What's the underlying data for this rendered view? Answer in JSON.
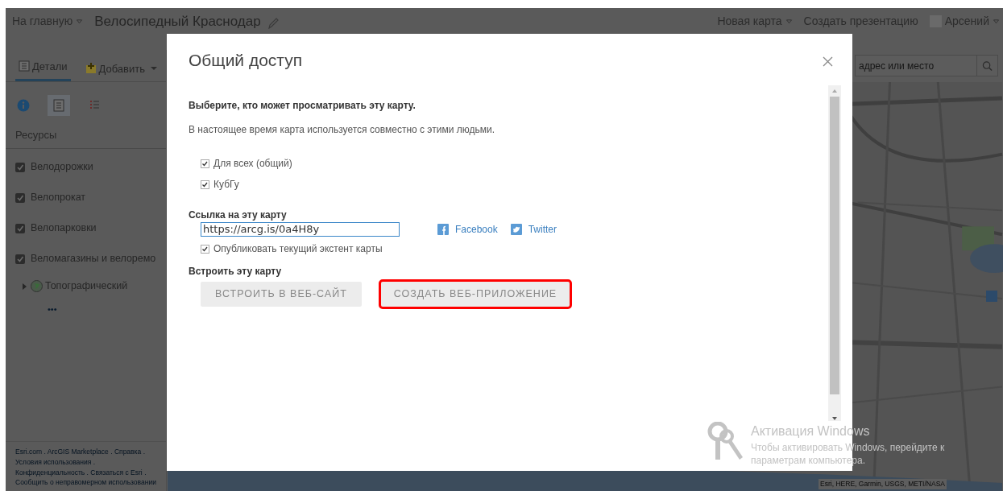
{
  "header": {
    "home": "На главную",
    "title": "Велосипедный Краснодар",
    "links": [
      {
        "label": "Новая карта",
        "dropdown": true
      },
      {
        "label": "Создать презентацию",
        "dropdown": false
      }
    ],
    "user": "Арсений"
  },
  "toolbar": {
    "tabs": [
      {
        "label": "Детали",
        "kind": "details",
        "selected": true,
        "dropdown": false
      },
      {
        "label": "Добавить",
        "kind": "add",
        "selected": false,
        "dropdown": true
      }
    ]
  },
  "panel": {
    "view_buttons": [
      {
        "kind": "info",
        "selected": false
      },
      {
        "kind": "content",
        "selected": true
      },
      {
        "kind": "legend",
        "selected": false
      }
    ],
    "heading": "Ресурсы",
    "layers": [
      {
        "label": "Велодорожки",
        "checked": true
      },
      {
        "label": "Велопрокат",
        "checked": true
      },
      {
        "label": "Велопарковки",
        "checked": true
      },
      {
        "label": "Веломагазины и велоремо",
        "checked": true
      }
    ],
    "basemap": {
      "label": "Топографический",
      "expanded": false,
      "more": "•••"
    },
    "footer_separator": ".",
    "footer_links": [
      "Esri.com",
      "ArcGIS Marketplace",
      "Справка",
      "Условия использования",
      "Конфиденциальность",
      "Связаться с Esri",
      "Сообщить о неправомерном использовании"
    ]
  },
  "search": {
    "placeholder": "адрес или место"
  },
  "map": {
    "attribution": "Esri, HERE, Garmin, USGS, METI/NASA"
  },
  "dialog": {
    "title": "Общий доступ",
    "who_heading": "Выберите, кто может просматривать эту карту.",
    "who_note": "В настоящее время карта используется совместно с этими людьми.",
    "audiences": [
      {
        "label": "Для всех (общий)",
        "checked": true
      },
      {
        "label": "КубГу",
        "checked": true
      }
    ],
    "link_heading": "Ссылка на эту карту",
    "link_value": "https://arcg.is/0a4H8y",
    "social": [
      {
        "label": "Facebook",
        "kind": "facebook"
      },
      {
        "label": "Twitter",
        "kind": "twitter"
      }
    ],
    "extent": {
      "label": "Опубликовать текущий экстент карты",
      "checked": true
    },
    "embed_heading": "Встроить эту карту",
    "buttons": [
      {
        "label": "ВСТРОИТЬ В ВЕБ-САЙТ",
        "highlighted": false
      },
      {
        "label": "СОЗДАТЬ ВЕБ-ПРИЛОЖЕНИЕ",
        "highlighted": true
      }
    ]
  },
  "os_notice": {
    "title": "Активация Windows",
    "text": "Чтобы активировать Windows, перейдите к параметрам компьютера."
  }
}
